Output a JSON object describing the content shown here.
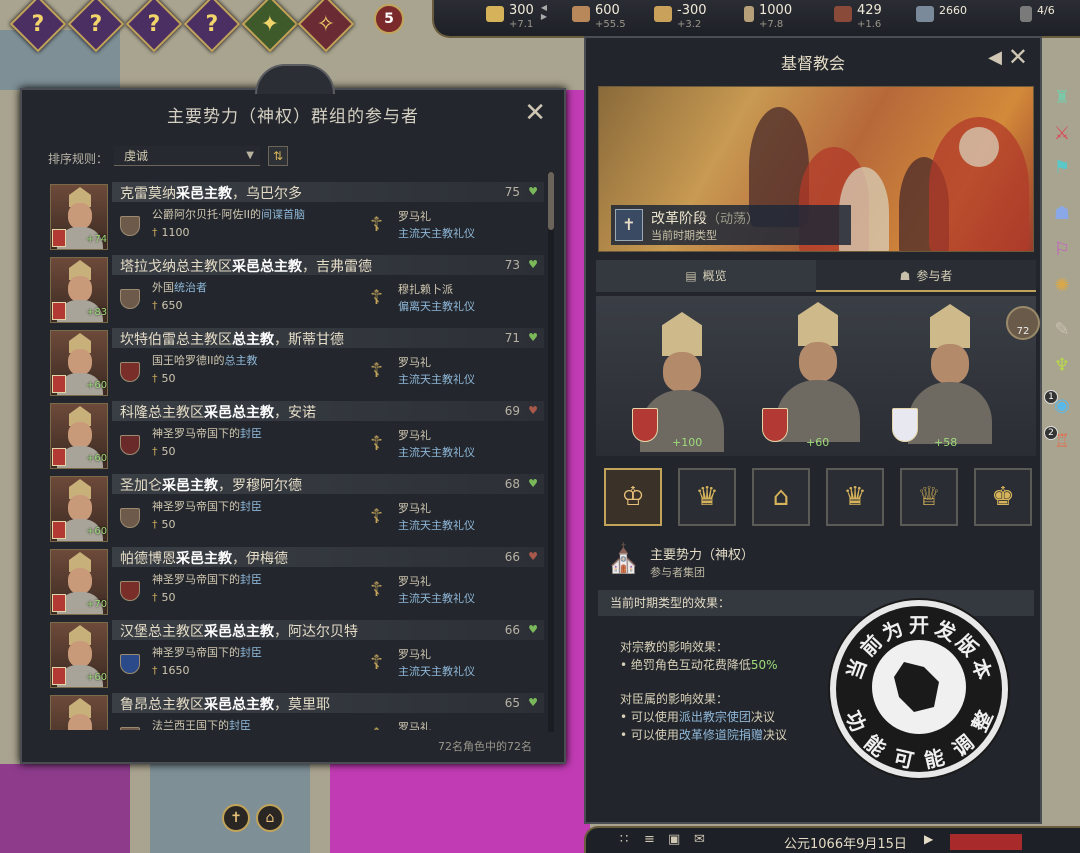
{
  "top": {
    "alerts": [
      {
        "label": "?",
        "kind": "question"
      },
      {
        "label": "?",
        "kind": "question"
      },
      {
        "label": "?",
        "kind": "question"
      },
      {
        "label": "?",
        "kind": "question"
      },
      {
        "label": "tree",
        "kind": "green"
      },
      {
        "label": "scroll",
        "kind": "red"
      }
    ],
    "alert_count": "5",
    "resources": [
      {
        "icon": "gold-icon",
        "value": "300",
        "delta": "+7.1",
        "color": "#d6b35a"
      },
      {
        "icon": "treasury-icon",
        "value": "600",
        "delta": "+55.5",
        "color": "#b8875a"
      },
      {
        "icon": "prestige-icon",
        "value": "-300",
        "delta": "+3.2",
        "color": "#c9a15a"
      },
      {
        "icon": "piety-icon",
        "value": "1000",
        "delta": "+7.8",
        "color": "#b5a07a"
      },
      {
        "icon": "renown-icon",
        "value": "429",
        "delta": "+1.6",
        "color": "#8a4a3a"
      },
      {
        "icon": "levy-icon",
        "value": "2660",
        "delta": "",
        "color": "#7a8a9a"
      }
    ],
    "domain_limit": "4/6"
  },
  "left_panel": {
    "title": "主要势力（神权）群组的参与者",
    "sort_label": "排序规则：",
    "sort_value": "虔诚",
    "footer": "72名角色中的72名",
    "rows": [
      {
        "name_pre": "克雷莫纳",
        "name_bold": "采邑主教",
        "name_post": "，乌巴尔多",
        "score": "75",
        "heart": "green",
        "opinion": "+74",
        "title_pre": "公爵阿尔贝托·阿佐II的",
        "title_link": "间谍首脑",
        "title_post": "",
        "stat": "1100",
        "faith": "罗马礼",
        "rite": "主流天主教礼仪",
        "icon": "scroll"
      },
      {
        "name_pre": "塔拉戈纳总主教区",
        "name_bold": "采邑总主教",
        "name_post": "，吉弗雷德",
        "score": "73",
        "heart": "green",
        "opinion": "+83",
        "title_pre": "外国",
        "title_link": "统治者",
        "title_post": "",
        "stat": "650",
        "faith": "穆扎赖卜派",
        "rite": "偏离天主教礼仪",
        "icon": "scroll"
      },
      {
        "name_pre": "坎特伯雷总主教区",
        "name_bold": "总主教",
        "name_post": "，斯蒂甘德",
        "score": "71",
        "heart": "green",
        "opinion": "+60",
        "title_pre": "国王哈罗德II的",
        "title_link": "总主教",
        "title_post": "",
        "stat": "50",
        "faith": "罗马礼",
        "rite": "主流天主教礼仪",
        "icon": "crest"
      },
      {
        "name_pre": "科隆总主教区",
        "name_bold": "采邑总主教",
        "name_post": "，安诺",
        "score": "69",
        "heart": "brown",
        "opinion": "+60",
        "title_pre": "神圣罗马帝国下的",
        "title_link": "封臣",
        "title_post": "",
        "stat": "50",
        "faith": "罗马礼",
        "rite": "主流天主教礼仪",
        "icon": "eagle"
      },
      {
        "name_pre": "圣加仑",
        "name_bold": "采邑主教",
        "name_post": "，罗穆阿尔德",
        "score": "68",
        "heart": "green",
        "opinion": "+60",
        "title_pre": "神圣罗马帝国下的",
        "title_link": "封臣",
        "title_post": "",
        "stat": "50",
        "faith": "罗马礼",
        "rite": "主流天主教礼仪",
        "icon": "scroll"
      },
      {
        "name_pre": "帕德博恩",
        "name_bold": "采邑主教",
        "name_post": "，伊梅德",
        "score": "66",
        "heart": "brown",
        "opinion": "+70",
        "title_pre": "神圣罗马帝国下的",
        "title_link": "封臣",
        "title_post": "",
        "stat": "50",
        "faith": "罗马礼",
        "rite": "主流天主教礼仪",
        "icon": "crest"
      },
      {
        "name_pre": "汉堡总主教区",
        "name_bold": "采邑总主教",
        "name_post": "，阿达尔贝特",
        "score": "66",
        "heart": "green",
        "opinion": "+60",
        "title_pre": "神圣罗马帝国下的",
        "title_link": "封臣",
        "title_post": "",
        "stat": "1650",
        "faith": "罗马礼",
        "rite": "主流天主教礼仪",
        "icon": "blue"
      },
      {
        "name_pre": "鲁昂总主教区",
        "name_bold": "采邑总主教",
        "name_post": "，莫里耶",
        "score": "65",
        "heart": "green",
        "opinion": "",
        "title_pre": "法兰西王国下的",
        "title_link": "封臣",
        "title_post": "",
        "stat": "",
        "faith": "罗马礼",
        "rite": "",
        "icon": "scroll"
      }
    ]
  },
  "right_panel": {
    "title": "基督教会",
    "phase_name": "改革阶段",
    "phase_mod": "（动荡）",
    "phase_sub": "当前时期类型",
    "tab_overview": "概览",
    "tab_participants": "参与者",
    "participant_count": "72",
    "bishops": [
      {
        "opinion": "+100"
      },
      {
        "opinion": "+60"
      },
      {
        "opinion": "+58"
      }
    ],
    "crowns": [
      "mitre-crown-icon",
      "crown-icon",
      "mitre-icon",
      "crown-icon",
      "helmet-crown-icon",
      "flame-crown-icon"
    ],
    "group_name": "主要势力（神权）",
    "group_sub": "参与者集团",
    "effects_header": "当前时期类型的效果：",
    "eff1_title": "对宗教的影响效果：",
    "eff1_pre": "• 绝罚角色互动花费降低",
    "eff1_val": "50%",
    "eff2_title": "对臣属的影响效果：",
    "eff2_a_pre": "• 可以使用",
    "eff2_a_link": "派出教宗使团",
    "eff2_a_post": "决议",
    "eff2_b_pre": "• 可以使用",
    "eff2_b_link": "改革修道院捐赠",
    "eff2_b_post": "决议"
  },
  "seal": {
    "top_text": "当前为开发版本",
    "bottom_text": "功能可能调整"
  },
  "side_icons": [
    "realm-icon",
    "war-icon",
    "faction-icon",
    "court-icon",
    "culture-icon",
    "religion-icon",
    "schemes-icon",
    "decisions-icon",
    "lifestyle-icon",
    "holding-icon"
  ],
  "side_numbers": [
    "1",
    "2"
  ],
  "bottom": {
    "date": "公元1066年9月15日",
    "speed_label": "▶"
  }
}
